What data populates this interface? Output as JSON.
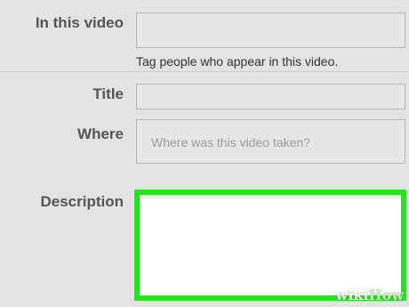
{
  "fields": {
    "in_this_video": {
      "label": "In this video",
      "hint": "Tag people who appear in this video."
    },
    "title": {
      "label": "Title"
    },
    "where": {
      "label": "Where",
      "placeholder": "Where was this video taken?"
    },
    "description": {
      "label": "Description",
      "highlight_color": "#22e61c"
    }
  },
  "watermark": {
    "part1": "wiki",
    "part2": "How"
  }
}
